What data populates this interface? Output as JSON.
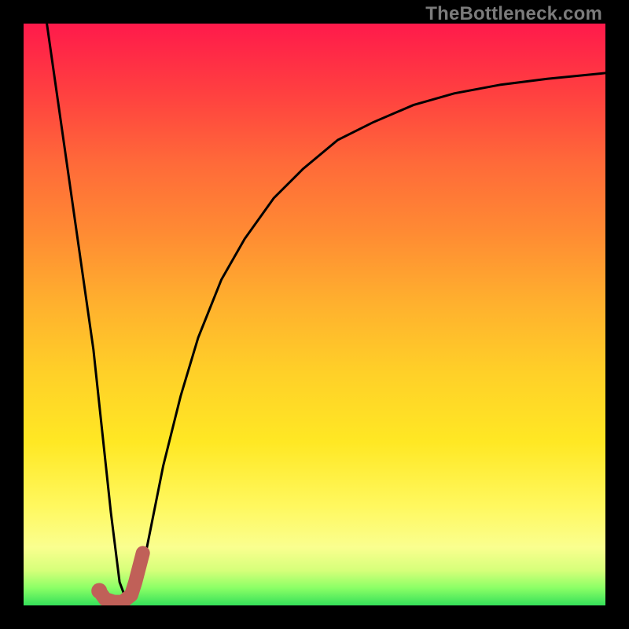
{
  "watermark": "TheBottleneck.com",
  "chart_data": {
    "type": "line",
    "title": "",
    "xlabel": "",
    "ylabel": "",
    "xlim": [
      0,
      100
    ],
    "ylim": [
      0,
      100
    ],
    "grid": false,
    "series": [
      {
        "name": "bottleneck-curve",
        "stroke": "#000000",
        "width": 3,
        "x": [
          4,
          6,
          8,
          10,
          12,
          13.5,
          15,
          16.5,
          18,
          20,
          22,
          24,
          27,
          30,
          34,
          38,
          43,
          48,
          54,
          60,
          67,
          74,
          82,
          90,
          100
        ],
        "y": [
          100,
          86,
          72,
          58,
          44,
          30,
          16,
          4,
          0,
          4,
          14,
          24,
          36,
          46,
          56,
          63,
          70,
          75,
          80,
          83,
          86,
          88,
          89.5,
          90.5,
          91.5
        ]
      },
      {
        "name": "marker-path",
        "stroke": "#c06058",
        "width": 18,
        "linecap": "round",
        "x": [
          13,
          14,
          15.5,
          17,
          18.5,
          19.2,
          20.5
        ],
        "y": [
          2.5,
          1.1,
          0.6,
          0.6,
          1.8,
          4.0,
          9.0
        ]
      }
    ],
    "marker_dot": {
      "x": 13,
      "y": 2.5,
      "r": 10,
      "fill": "#c06058"
    }
  }
}
